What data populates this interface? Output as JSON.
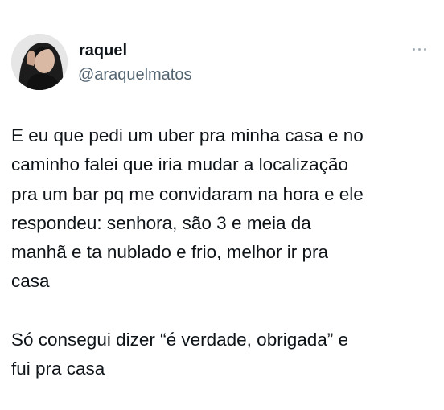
{
  "user": {
    "name": "raquel",
    "handle": "@araquelmatos"
  },
  "tweet": {
    "paragraph1": [
      "E eu que pedi um uber pra minha casa e no",
      "caminho falei que iria mudar a localização",
      "pra um bar pq me convidaram na hora e ele",
      "respondeu: senhora, são 3 e meia da",
      "manhã e ta nublado e frio, melhor ir pra",
      "casa"
    ],
    "paragraph2": [
      "Só consegui dizer “é verdade, obrigada” e",
      "fui pra casa"
    ]
  },
  "icons": {
    "more": "more-horizontal-icon"
  },
  "colors": {
    "text": "#0f1419",
    "secondary": "#536471",
    "background": "#ffffff"
  }
}
